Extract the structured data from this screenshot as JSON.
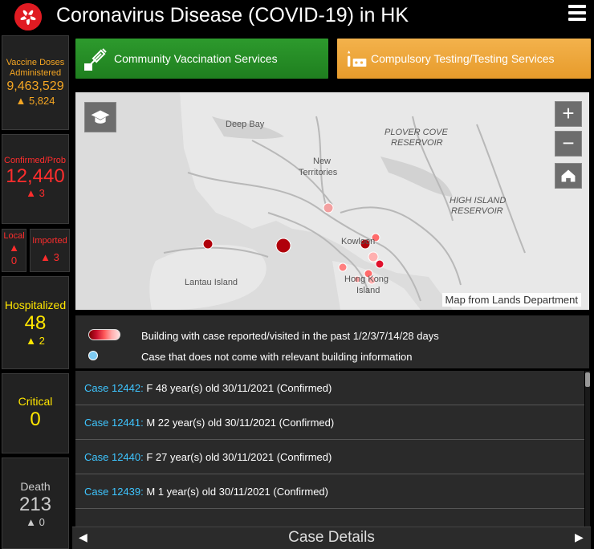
{
  "header": {
    "title": "Coronavirus Disease (COVID-19) in HK",
    "logo_icon": "bauhinia-logo-icon",
    "menu_icon": "hamburger-menu-icon"
  },
  "stats": {
    "vaccine": {
      "label_line1": "Vaccine Doses",
      "label_line2": "Administered",
      "value": "9,463,529",
      "delta": "▲ 5,824",
      "color": "#f5a623"
    },
    "confirmed": {
      "label": "Confirmed/Prob",
      "value": "12,440",
      "delta": "▲ 3",
      "color": "#ff2d2d"
    },
    "local": {
      "label": "Local",
      "delta_arrow": "▲",
      "value": "0"
    },
    "imported": {
      "label": "Imported",
      "delta": "▲ 3"
    },
    "hospitalized": {
      "label": "Hospitalized",
      "value": "48",
      "delta": "▲ 2",
      "color": "#ffe600"
    },
    "critical": {
      "label": "Critical",
      "value": "0"
    },
    "death": {
      "label": "Death",
      "value": "213",
      "delta": "▲ 0"
    }
  },
  "services": {
    "vaccination": {
      "label": "Community Vaccination Services",
      "color": "#2d9a2d"
    },
    "testing": {
      "label": "Compulsory Testing/Testing Services",
      "color": "#f3b24c"
    }
  },
  "map": {
    "labels": {
      "deep_bay": "Deep Bay",
      "new_territories_1": "New",
      "new_territories_2": "Territories",
      "plover_1": "PLOVER COVE",
      "plover_2": "RESERVOIR",
      "high_island_1": "HIGH ISLAND",
      "high_island_2": "RESERVOIR",
      "lantau": "Lantau Island",
      "kowloon": "Kowloon",
      "hong_kong_1": "Hong Kong",
      "hong_kong_2": "Island"
    },
    "zoom_in": "+",
    "zoom_out": "−",
    "attribution": "Map from Lands Department"
  },
  "legend": {
    "building_text": "Building with case reported/visited in the past 1/2/3/7/14/28 days",
    "no_building_text": "Case that does not come with relevant building information"
  },
  "cases": [
    {
      "id": "Case 12442:",
      "detail": "F  48 year(s) old  30/11/2021 (Confirmed)"
    },
    {
      "id": "Case 12441:",
      "detail": "M  22 year(s) old  30/11/2021 (Confirmed)"
    },
    {
      "id": "Case 12440:",
      "detail": "F  27 year(s) old  30/11/2021 (Confirmed)"
    },
    {
      "id": "Case 12439:",
      "detail": "M  1 year(s) old  30/11/2021 (Confirmed)"
    }
  ],
  "footer": {
    "title": "Case Details",
    "prev_arrow": "◀",
    "next_arrow": "▶"
  }
}
